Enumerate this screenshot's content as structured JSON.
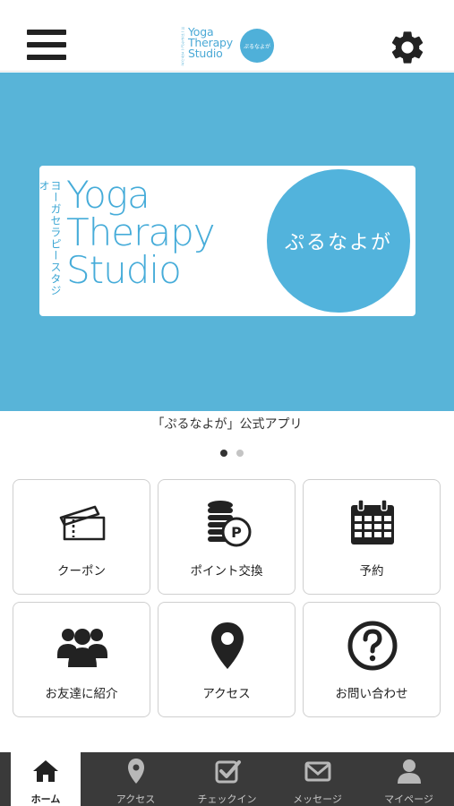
{
  "header": {
    "logo": {
      "vertical_text": "ヨーガセラピースタジオ",
      "lines": [
        "Yoga",
        "Therapy",
        "Studio"
      ],
      "circle_text": "ぷるなよが"
    },
    "menu_icon": "hamburger-menu-icon",
    "settings_icon": "gear-icon"
  },
  "banner": {
    "vertical_text": "ヨーガセラピースタジオ",
    "lines": [
      "Yoga",
      "Therapy",
      "Studio"
    ],
    "circle_text": "ぷるなよが",
    "background": "#58b4d8",
    "slide_count": 2,
    "active_slide": 1
  },
  "caption": "「ぷるなよが」公式アプリ",
  "grid": [
    {
      "label": "クーポン",
      "icon": "ticket-icon"
    },
    {
      "label": "ポイント交換",
      "icon": "coins-point-icon"
    },
    {
      "label": "予約",
      "icon": "calendar-icon"
    },
    {
      "label": "お友達に紹介",
      "icon": "group-users-icon"
    },
    {
      "label": "アクセス",
      "icon": "map-pin-icon"
    },
    {
      "label": "お問い合わせ",
      "icon": "question-circle-icon"
    }
  ],
  "tabbar": [
    {
      "label": "ホーム",
      "icon": "home-icon",
      "active": true
    },
    {
      "label": "アクセス",
      "icon": "map-pin-icon"
    },
    {
      "label": "チェックイン",
      "icon": "checkin-checkbox-icon"
    },
    {
      "label": "メッセージ",
      "icon": "envelope-icon"
    },
    {
      "label": "マイページ",
      "icon": "user-icon"
    }
  ],
  "colors": {
    "accent": "#58b4d8",
    "tabbar": "#3a3a3a",
    "icon": "#222222"
  }
}
